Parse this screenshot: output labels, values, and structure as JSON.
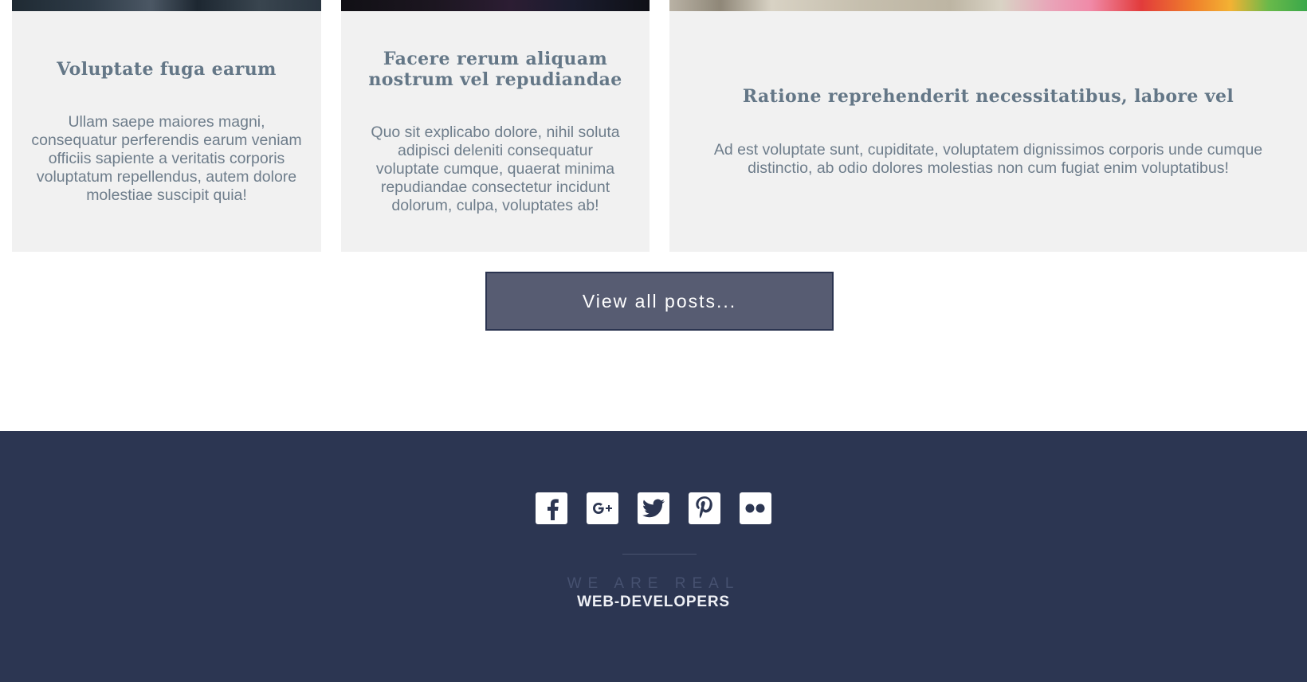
{
  "posts": [
    {
      "title": "Voluptate fuga earum",
      "excerpt": "Ullam saepe maiores magni, consequatur perferendis earum veniam officiis sapiente a veritatis corporis voluptatum repellendus, autem dolore molestiae suscipit quia!"
    },
    {
      "title": "Facere rerum aliquam nostrum vel repudiandae",
      "excerpt": "Quo sit explicabo dolore, nihil soluta adipisci deleniti consequatur voluptate cumque, quaerat minima repudiandae consectetur incidunt dolorum, culpa, voluptates ab!"
    },
    {
      "title": "Ratione reprehenderit necessitatibus, labore vel",
      "excerpt": "Ad est voluptate sunt, cupiditate, voluptatem dignissimos corporis unde cumque distinctio, ab odio dolores molestias non cum fugiat enim voluptatibus!"
    }
  ],
  "view_all_label": "View all posts...",
  "footer": {
    "social_icons": [
      "facebook-icon",
      "google-plus-icon",
      "twitter-icon",
      "pinterest-icon",
      "flickr-icon"
    ],
    "tagline_top": "WE ARE REAL",
    "tagline_bottom": "WEB-DEVELOPERS"
  },
  "colors": {
    "card_bg": "#f1f1f1",
    "title": "#647787",
    "text": "#6e7d8b",
    "button_bg": "#575c72",
    "footer_bg": "#2c3652"
  }
}
